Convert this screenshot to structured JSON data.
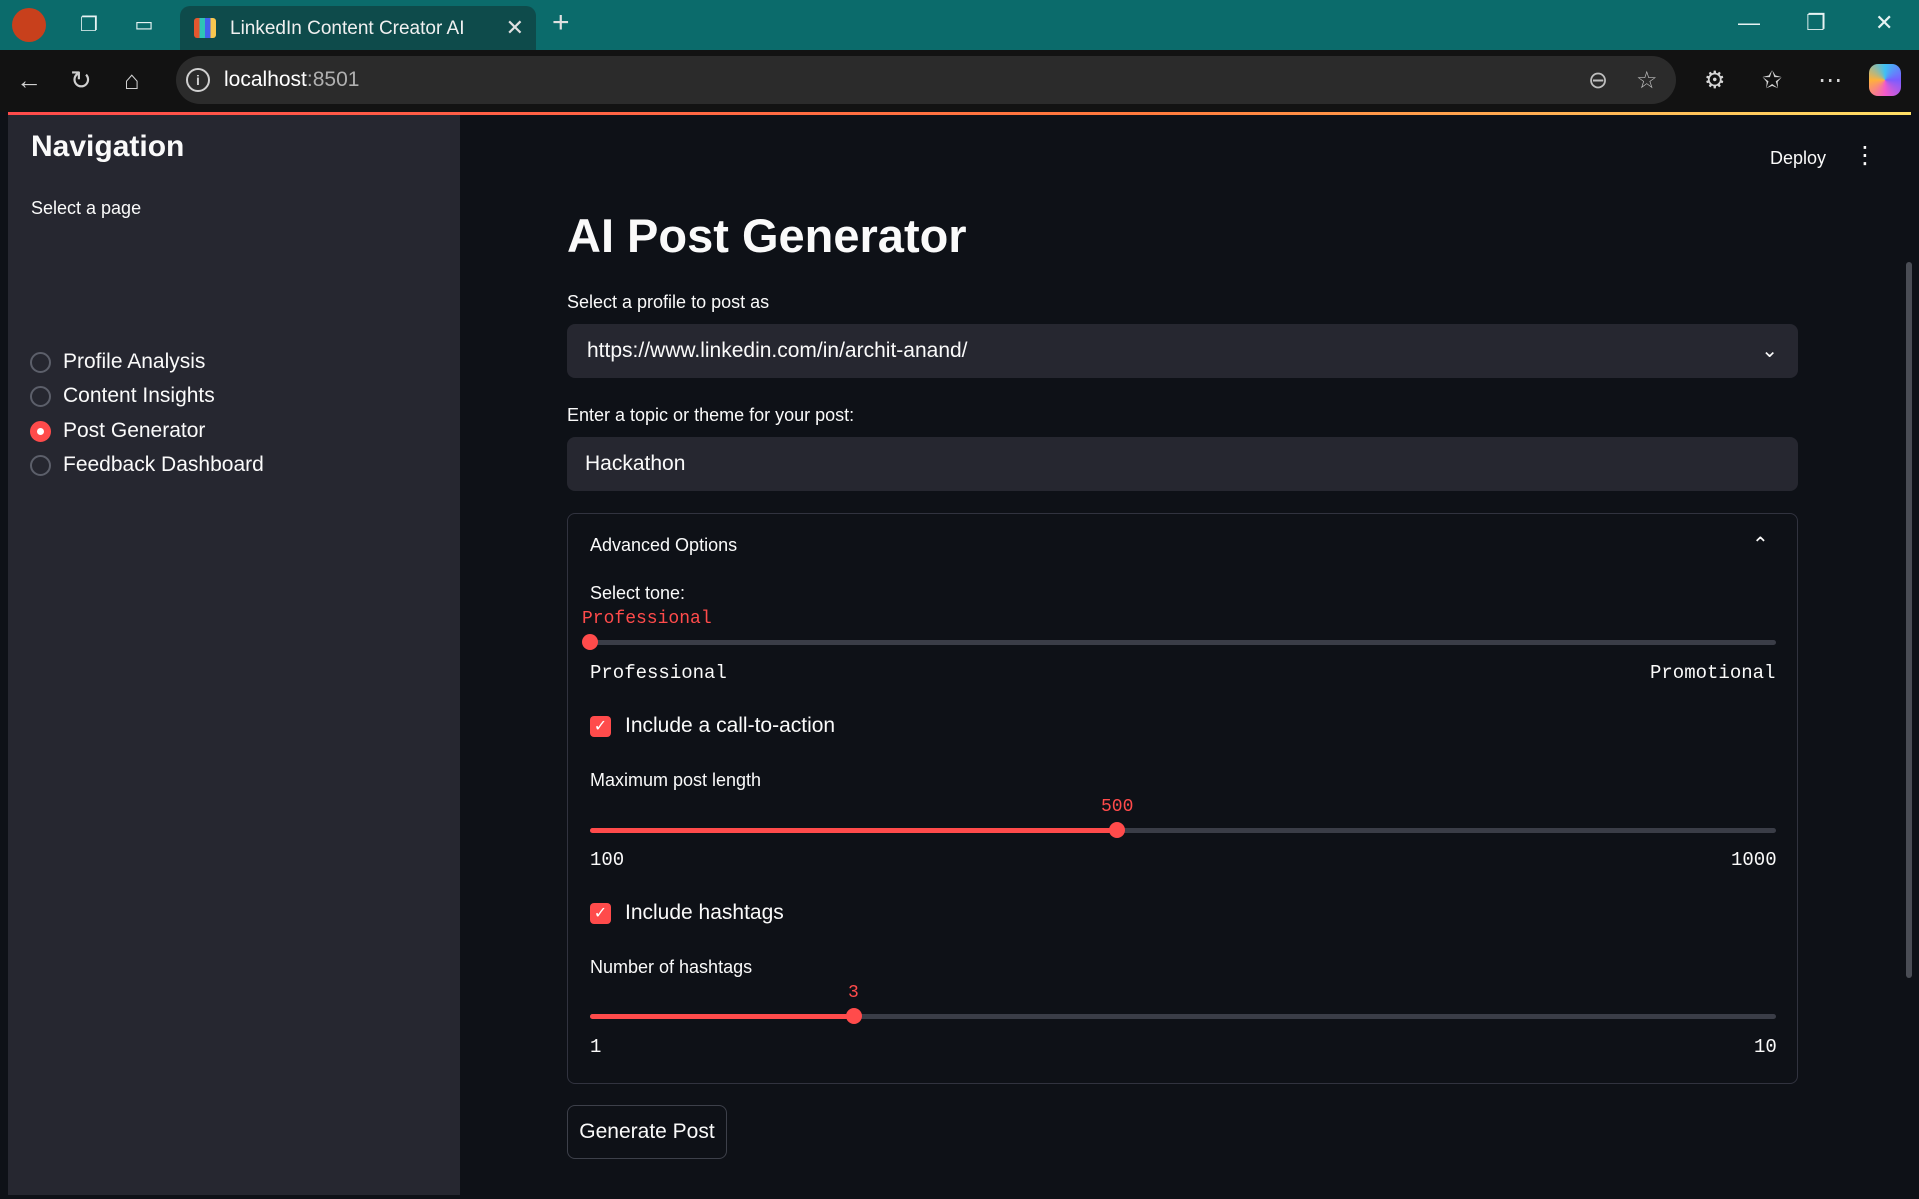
{
  "browser": {
    "tab_title": "LinkedIn Content Creator AI",
    "url_host": "localhost",
    "url_port": ":8501"
  },
  "header": {
    "deploy_label": "Deploy"
  },
  "sidebar": {
    "title": "Navigation",
    "select_label": "Select a page",
    "items": [
      {
        "label": "Profile Analysis",
        "selected": false
      },
      {
        "label": "Content Insights",
        "selected": false
      },
      {
        "label": "Post Generator",
        "selected": true
      },
      {
        "label": "Feedback Dashboard",
        "selected": false
      }
    ]
  },
  "main": {
    "title": "AI Post Generator",
    "profile_label": "Select a profile to post as",
    "profile_value": "https://www.linkedin.com/in/archit-anand/",
    "topic_label": "Enter a topic or theme for your post:",
    "topic_value": "Hackathon",
    "advanced": {
      "title": "Advanced Options",
      "tone": {
        "label": "Select tone:",
        "value": "Professional",
        "min_label": "Professional",
        "max_label": "Promotional",
        "position": 0
      },
      "cta": {
        "label": "Include a call-to-action",
        "checked": true
      },
      "length": {
        "label": "Maximum post length",
        "value": "500",
        "min": "100",
        "max": "1000",
        "fraction": 0.4444
      },
      "hashtags": {
        "label": "Include hashtags",
        "checked": true
      },
      "num_hashtags": {
        "label": "Number of hashtags",
        "value": "3",
        "min": "1",
        "max": "10",
        "fraction": 0.2222
      }
    },
    "generate_label": "Generate Post"
  },
  "colors": {
    "accent": "#ff4b4b",
    "sidebar_bg": "#262730",
    "main_bg": "#0e1117"
  }
}
